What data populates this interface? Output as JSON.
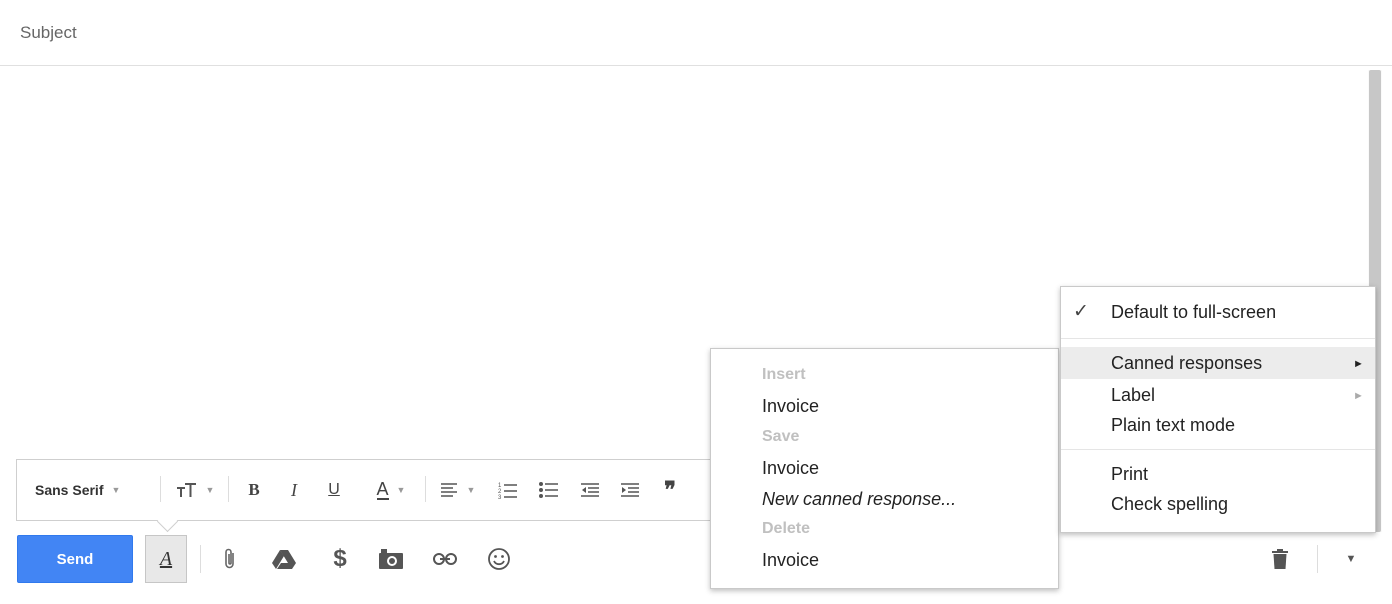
{
  "subject": {
    "placeholder": "Subject"
  },
  "format_bar": {
    "font_name": "Sans Serif",
    "tools": [
      "font-size-icon",
      "bold-icon",
      "italic-icon",
      "underline-icon",
      "text-color-icon",
      "align-icon",
      "numbered-list-icon",
      "bulleted-list-icon",
      "indent-less-icon",
      "indent-more-icon",
      "quote-icon"
    ]
  },
  "toolbar": {
    "send_label": "Send",
    "format_toggle_label": "A",
    "tools": [
      "attach-icon",
      "drive-icon",
      "money-icon",
      "photo-icon",
      "link-icon",
      "emoji-icon"
    ]
  },
  "more_menu": {
    "default_fullscreen": "Default to full-screen",
    "default_fullscreen_checked": true,
    "canned_responses": "Canned responses",
    "label": "Label",
    "plain_text": "Plain text mode",
    "print": "Print",
    "check_spelling": "Check spelling"
  },
  "canned_menu": {
    "insert_header": "Insert",
    "insert_item": "Invoice",
    "save_header": "Save",
    "save_item": "Invoice",
    "new_response": "New canned response...",
    "delete_header": "Delete",
    "delete_item": "Invoice"
  },
  "colors": {
    "send": "#4285f4",
    "highlight": "#ececec",
    "header_gray": "#c0c0c0"
  }
}
